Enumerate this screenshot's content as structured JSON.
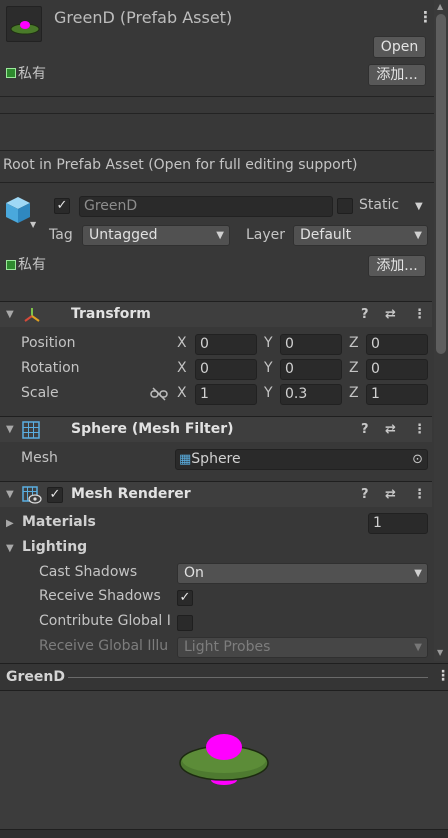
{
  "header": {
    "title": "GreenD (Prefab Asset)",
    "open_button": "Open",
    "label_tag": "私有",
    "add_button": "添加..."
  },
  "root_notice": "Root in Prefab Asset (Open for full editing support)",
  "object": {
    "name": "GreenD",
    "static_label": "Static",
    "tag_label": "Tag",
    "tag_value": "Untagged",
    "layer_label": "Layer",
    "layer_value": "Default",
    "label_tag": "私有",
    "add_button": "添加..."
  },
  "transform": {
    "title": "Transform",
    "position_label": "Position",
    "rotation_label": "Rotation",
    "scale_label": "Scale",
    "axis_x": "X",
    "axis_y": "Y",
    "axis_z": "Z",
    "position": {
      "x": "0",
      "y": "0",
      "z": "0"
    },
    "rotation": {
      "x": "0",
      "y": "0",
      "z": "0"
    },
    "scale": {
      "x": "1",
      "y": "0.3",
      "z": "1"
    }
  },
  "mesh_filter": {
    "title": "Sphere (Mesh Filter)",
    "mesh_label": "Mesh",
    "mesh_value": "Sphere"
  },
  "mesh_renderer": {
    "title": "Mesh Renderer",
    "materials_label": "Materials",
    "materials_count": "1",
    "lighting_label": "Lighting",
    "cast_shadows_label": "Cast Shadows",
    "cast_shadows_value": "On",
    "receive_shadows_label": "Receive Shadows",
    "contribute_gi_label": "Contribute Global I",
    "receive_gi_label": "Receive Global Illu",
    "receive_gi_value": "Light Probes"
  },
  "preview": {
    "title": "GreenD"
  },
  "colors": {
    "panel": "#383838",
    "field": "#2a2a2a",
    "disc_green": "#4a7a2a",
    "dome_magenta": "#ff00ff"
  }
}
